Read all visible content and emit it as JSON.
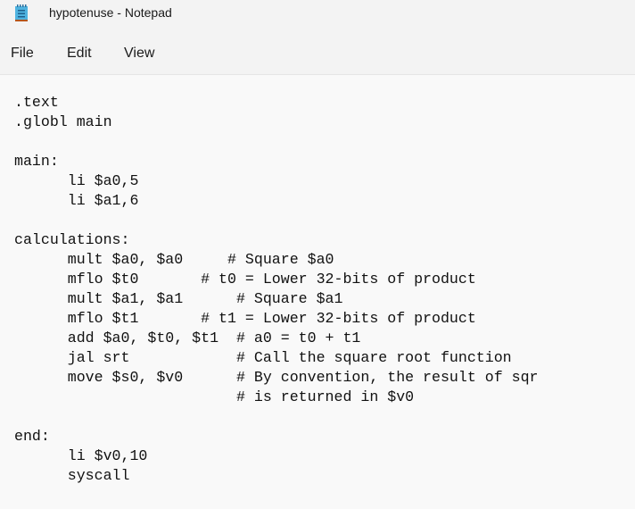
{
  "window": {
    "title": "hypotenuse - Notepad",
    "icon": "notepad-icon"
  },
  "menu": {
    "items": [
      "File",
      "Edit",
      "View"
    ]
  },
  "editor": {
    "lines": [
      ".text",
      ".globl main",
      "",
      "main:",
      "      li $a0,5",
      "      li $a1,6",
      "",
      "calculations:",
      "      mult $a0, $a0     # Square $a0",
      "      mflo $t0       # t0 = Lower 32-bits of product",
      "      mult $a1, $a1      # Square $a1",
      "      mflo $t1       # t1 = Lower 32-bits of product",
      "      add $a0, $t0, $t1  # a0 = t0 + t1",
      "      jal srt            # Call the square root function",
      "      move $s0, $v0      # By convention, the result of sqr",
      "                         # is returned in $v0",
      "",
      "end:",
      "      li $v0,10",
      "      syscall"
    ]
  }
}
